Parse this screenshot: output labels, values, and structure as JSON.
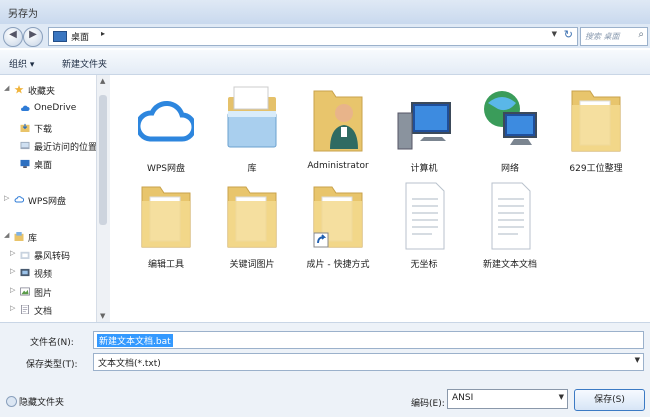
{
  "window": {
    "title": "另存为"
  },
  "address": {
    "location": "桌面",
    "search_placeholder": "搜索 桌面"
  },
  "toolbar": {
    "organize": "组织 ▾",
    "new_folder": "新建文件夹"
  },
  "sidebar": {
    "items": [
      {
        "label": "收藏夹",
        "icon": "star-icon"
      },
      {
        "label": "OneDrive",
        "icon": "cloud-icon"
      },
      {
        "label": "下载",
        "icon": "download-folder-icon"
      },
      {
        "label": "最近访问的位置",
        "icon": "recent-places-icon"
      },
      {
        "label": "桌面",
        "icon": "desktop-icon"
      },
      {
        "label": "WPS网盘",
        "icon": "cloud-icon"
      },
      {
        "label": "库",
        "icon": "library-icon"
      },
      {
        "label": "暴风转码",
        "icon": "library-folder-icon"
      },
      {
        "label": "视频",
        "icon": "video-icon"
      },
      {
        "label": "图片",
        "icon": "picture-icon"
      },
      {
        "label": "文档",
        "icon": "document-icon"
      }
    ]
  },
  "files": [
    {
      "name": "WPS网盘",
      "icon": "wps-cloud-icon"
    },
    {
      "name": "库",
      "icon": "library-folder-icon"
    },
    {
      "name": "Administrator",
      "icon": "user-folder-icon"
    },
    {
      "name": "计算机",
      "icon": "computer-icon"
    },
    {
      "name": "网络",
      "icon": "network-globe-icon"
    },
    {
      "name": "629工位整理",
      "icon": "folder-icon"
    },
    {
      "name": "编辑工具",
      "icon": "folder-icon"
    },
    {
      "name": "关键词图片",
      "icon": "folder-icon"
    },
    {
      "name": "成片 - 快捷方式",
      "icon": "folder-shortcut-icon"
    },
    {
      "name": "无坐标",
      "icon": "text-file-icon"
    },
    {
      "name": "新建文本文档",
      "icon": "text-file-icon"
    }
  ],
  "form": {
    "filename_label": "文件名(N):",
    "filename_value": "新建文本文档.bat",
    "filetype_label": "保存类型(T):",
    "filetype_value": "文本文档(*.txt)",
    "hide_folders": "隐藏文件夹",
    "encoding_label": "编码(E):",
    "encoding_value": "ANSI",
    "save": "保存(S)"
  }
}
